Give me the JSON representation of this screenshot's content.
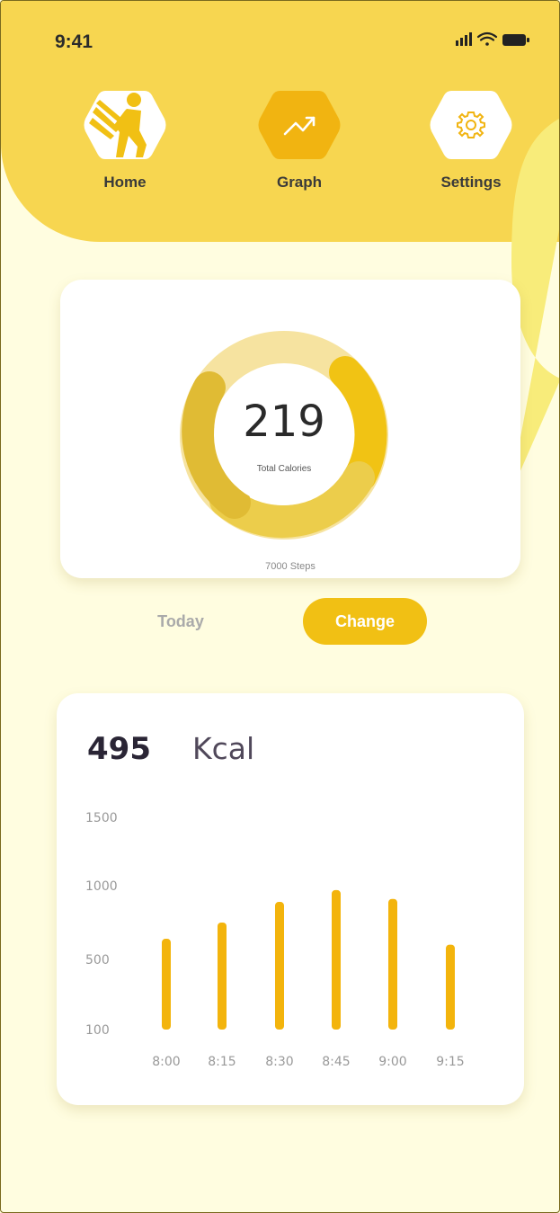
{
  "status_bar": {
    "time": "9:41"
  },
  "nav": {
    "items": [
      {
        "label": "Home",
        "icon": "runner-icon"
      },
      {
        "label": "Graph",
        "icon": "trend-up-icon"
      },
      {
        "label": "Settings",
        "icon": "gear-icon"
      }
    ],
    "active": "Graph"
  },
  "calories_card": {
    "value": "219",
    "label": "Total Calories",
    "steps": "7000 Steps"
  },
  "controls": {
    "today_label": "Today",
    "change_label": "Change"
  },
  "summary": {
    "value": "495",
    "unit": "Kcal"
  },
  "colors": {
    "accent": "#f1c014",
    "header": "#f7d650",
    "bar": "#f3b40c",
    "bubble": "#f8ec7a"
  },
  "chart_data": {
    "type": "bar",
    "categories": [
      "8:00",
      "8:15",
      "8:30",
      "8:45",
      "9:00",
      "9:15"
    ],
    "values": [
      640,
      750,
      890,
      970,
      910,
      600
    ],
    "yticks": [
      "100",
      "500",
      "1000",
      "1500"
    ],
    "ylim": [
      100,
      1500
    ],
    "title": "",
    "xlabel": "",
    "ylabel": ""
  }
}
